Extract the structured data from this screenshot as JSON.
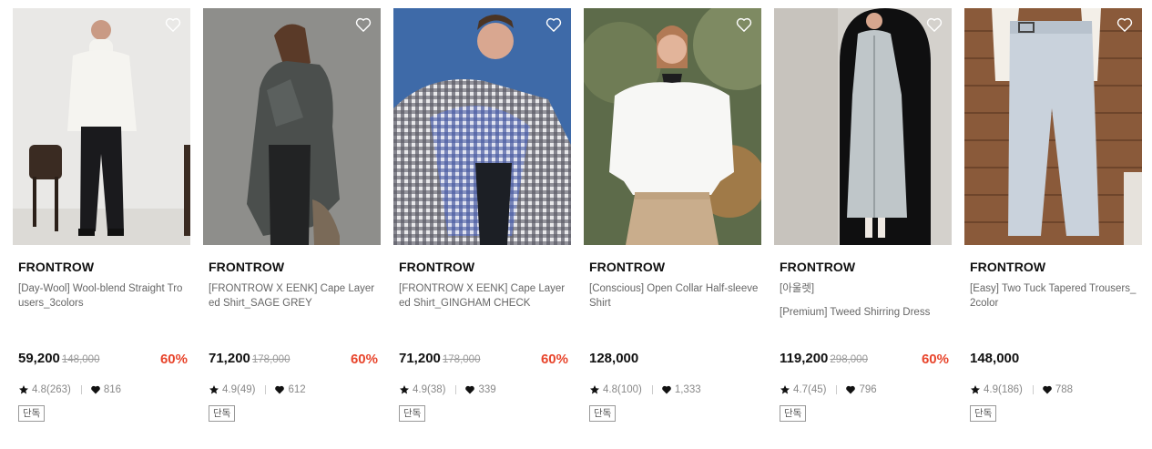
{
  "products": [
    {
      "brand": "FRONTROW",
      "name": "[Day-Wool] Wool-blend Straight Trousers_3colors",
      "name_extra": "",
      "price": "59,200",
      "original_price": "148,000",
      "discount": "60%",
      "rating": "4.8(263)",
      "likes": "816",
      "badge": "단독"
    },
    {
      "brand": "FRONTROW",
      "name": "[FRONTROW X EENK] Cape Layered Shirt_SAGE GREY",
      "name_extra": "",
      "price": "71,200",
      "original_price": "178,000",
      "discount": "60%",
      "rating": "4.9(49)",
      "likes": "612",
      "badge": "단독"
    },
    {
      "brand": "FRONTROW",
      "name": "[FRONTROW X EENK] Cape Layered Shirt_GINGHAM CHECK",
      "name_extra": "",
      "price": "71,200",
      "original_price": "178,000",
      "discount": "60%",
      "rating": "4.9(38)",
      "likes": "339",
      "badge": "단독"
    },
    {
      "brand": "FRONTROW",
      "name": "[Conscious] Open Collar Half-sleeve Shirt",
      "name_extra": "",
      "price": "128,000",
      "original_price": "",
      "discount": "",
      "rating": "4.8(100)",
      "likes": "1,333",
      "badge": "단독"
    },
    {
      "brand": "FRONTROW",
      "name": "[아울렛]",
      "name_extra": "[Premium] Tweed Shirring Dress",
      "price": "119,200",
      "original_price": "298,000",
      "discount": "60%",
      "rating": "4.7(45)",
      "likes": "796",
      "badge": "단독"
    },
    {
      "brand": "FRONTROW",
      "name": "[Easy] Two Tuck Tapered Trousers_2color",
      "name_extra": "",
      "price": "148,000",
      "original_price": "",
      "discount": "",
      "rating": "4.9(186)",
      "likes": "788",
      "badge": "단독"
    }
  ],
  "icons": {
    "wishlist": "heart-outline-icon",
    "rating": "star-icon",
    "likes": "heart-filled-icon"
  },
  "colors": {
    "discount": "#e8452c",
    "text_primary": "#111111",
    "text_secondary": "#666666"
  }
}
